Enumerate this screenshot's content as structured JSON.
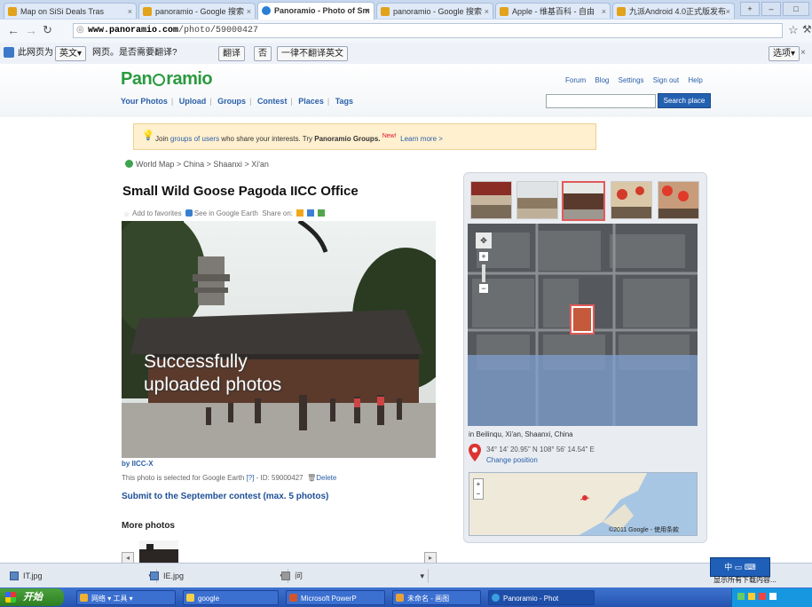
{
  "browser": {
    "tabs": [
      {
        "label": "Map on SiSi Deals Tras"
      },
      {
        "label": "panoramio - Google 搜索"
      },
      {
        "label": "Panoramio - Photo of Sm"
      },
      {
        "label": "panoramio - Google 搜索"
      },
      {
        "label": "Apple - 维基百科 - 自由"
      },
      {
        "label": "九派Android 4.0正式版发布"
      }
    ],
    "active_tab_index": 2,
    "url_host": "www.panoramio.com",
    "url_path": "/photo/59000427"
  },
  "translate_bar": {
    "prompt": "此网页为",
    "language": "英文▾",
    "question": "网页。是否需要翻译?",
    "translate_button": "翻译",
    "no_button": "否",
    "never_button": "一律不翻译英文",
    "options_button": "选项▾"
  },
  "site": {
    "logo": {
      "before": "Pan",
      "after": "ramio"
    },
    "nav": [
      "Your Photos",
      "Upload",
      "Groups",
      "Contest",
      "Places",
      "Tags"
    ],
    "top_links": [
      "Forum",
      "Blog",
      "Settings",
      "Sign out",
      "Help"
    ],
    "search_button": "Search place"
  },
  "promo": {
    "text_before": "Join",
    "link": "groups of users",
    "text_after": "who share your interests. Try",
    "brand": "Panoramio Groups.",
    "new_badge": "New!",
    "learn_more": "Learn more >"
  },
  "breadcrumb": [
    "World Map",
    "China",
    "Shaanxi",
    "Xi'an"
  ],
  "photo": {
    "title": "Small Wild Goose Pagoda IICC Office",
    "actions": {
      "favorites": "Add to favorites",
      "earth": "See in Google Earth",
      "share": "Share on:"
    },
    "overlay_line1": "Successfully",
    "overlay_line2": "uploaded photos",
    "byline": "by IICC-X",
    "selected_info": "This photo is selected for Google Earth",
    "help_mark": "[?]",
    "id_text": "- ID: 59000427",
    "delete": "Delete",
    "submit_contest": "Submit to the September contest (max. 5 photos)",
    "more_photos": "More photos"
  },
  "location": {
    "place": "in Beilinqu, Xi'an, Shaanxi, China",
    "coords": "34° 14' 20.95\" N  108° 56' 14.54\" E",
    "change_position": "Change position",
    "copyright": "©2011 Google - 使用条款"
  },
  "downloads": [
    {
      "name": "IT.jpg"
    },
    {
      "name": "IE.jpg"
    },
    {
      "name": "问"
    }
  ],
  "ime_panel": {
    "label": "中 ▭ ⌨"
  },
  "show_all_downloads": "显示所有下载内容...",
  "taskbar": {
    "start": "开始",
    "items": [
      {
        "label": "网络 ▾ 工具 ▾"
      },
      {
        "label": "google"
      },
      {
        "label": "Microsoft PowerP"
      },
      {
        "label": "未命名 - 画图"
      },
      {
        "label": "Panoramio - Phot"
      }
    ]
  },
  "colors": {
    "brand_green": "#2b9a3f",
    "link_blue": "#2a5fa8",
    "taskbar_blue": "#2553b0"
  }
}
